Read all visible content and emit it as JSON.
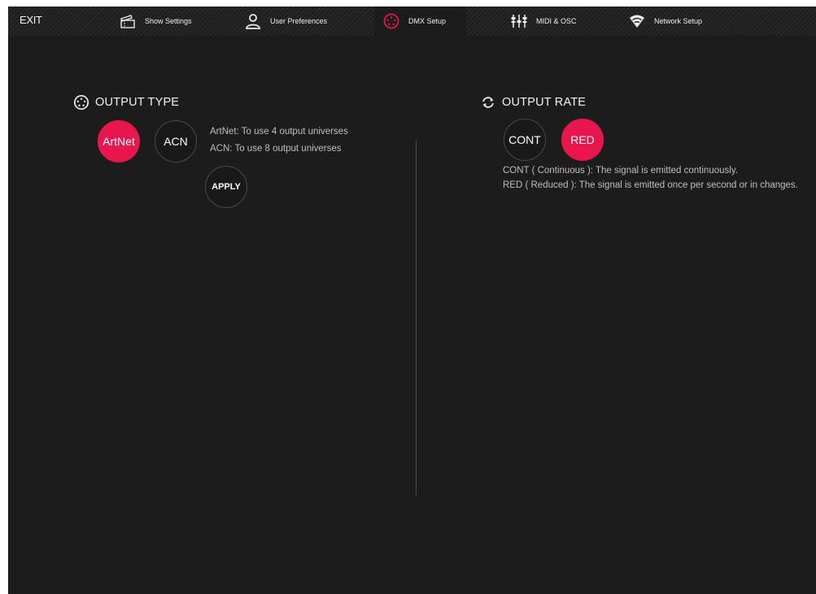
{
  "topbar": {
    "exit_label": "EXIT",
    "tabs": [
      {
        "label": "Show Settings",
        "icon": "ticket-icon"
      },
      {
        "label": "User Preferences",
        "icon": "user-icon"
      },
      {
        "label": "DMX Setup",
        "icon": "dmx-connector-icon",
        "active": true
      },
      {
        "label": "MIDI & OSC",
        "icon": "midi-sliders-icon"
      },
      {
        "label": "Network Setup",
        "icon": "wifi-icon"
      }
    ]
  },
  "output_type": {
    "title": "OUTPUT TYPE",
    "icon": "dmx-connector-icon",
    "options": [
      {
        "label": "ArtNet",
        "selected": true
      },
      {
        "label": "ACN",
        "selected": false
      }
    ],
    "info": [
      "ArtNet: To use 4 output universes",
      "ACN: To use 8 output universes"
    ],
    "apply_label": "APPLY"
  },
  "output_rate": {
    "title": "OUTPUT RATE",
    "icon": "refresh-icon",
    "options": [
      {
        "label": "CONT",
        "selected": false
      },
      {
        "label": "RED",
        "selected": true
      }
    ],
    "info": [
      "CONT ( Continuous ): The signal is emitted continuously.",
      "RED ( Reduced ): The signal is emitted once per second or in changes."
    ]
  },
  "colors": {
    "accent": "#e8164d",
    "background": "#1c1c1d",
    "text": "#f2f2f2",
    "muted_text": "#bfbfbf"
  }
}
